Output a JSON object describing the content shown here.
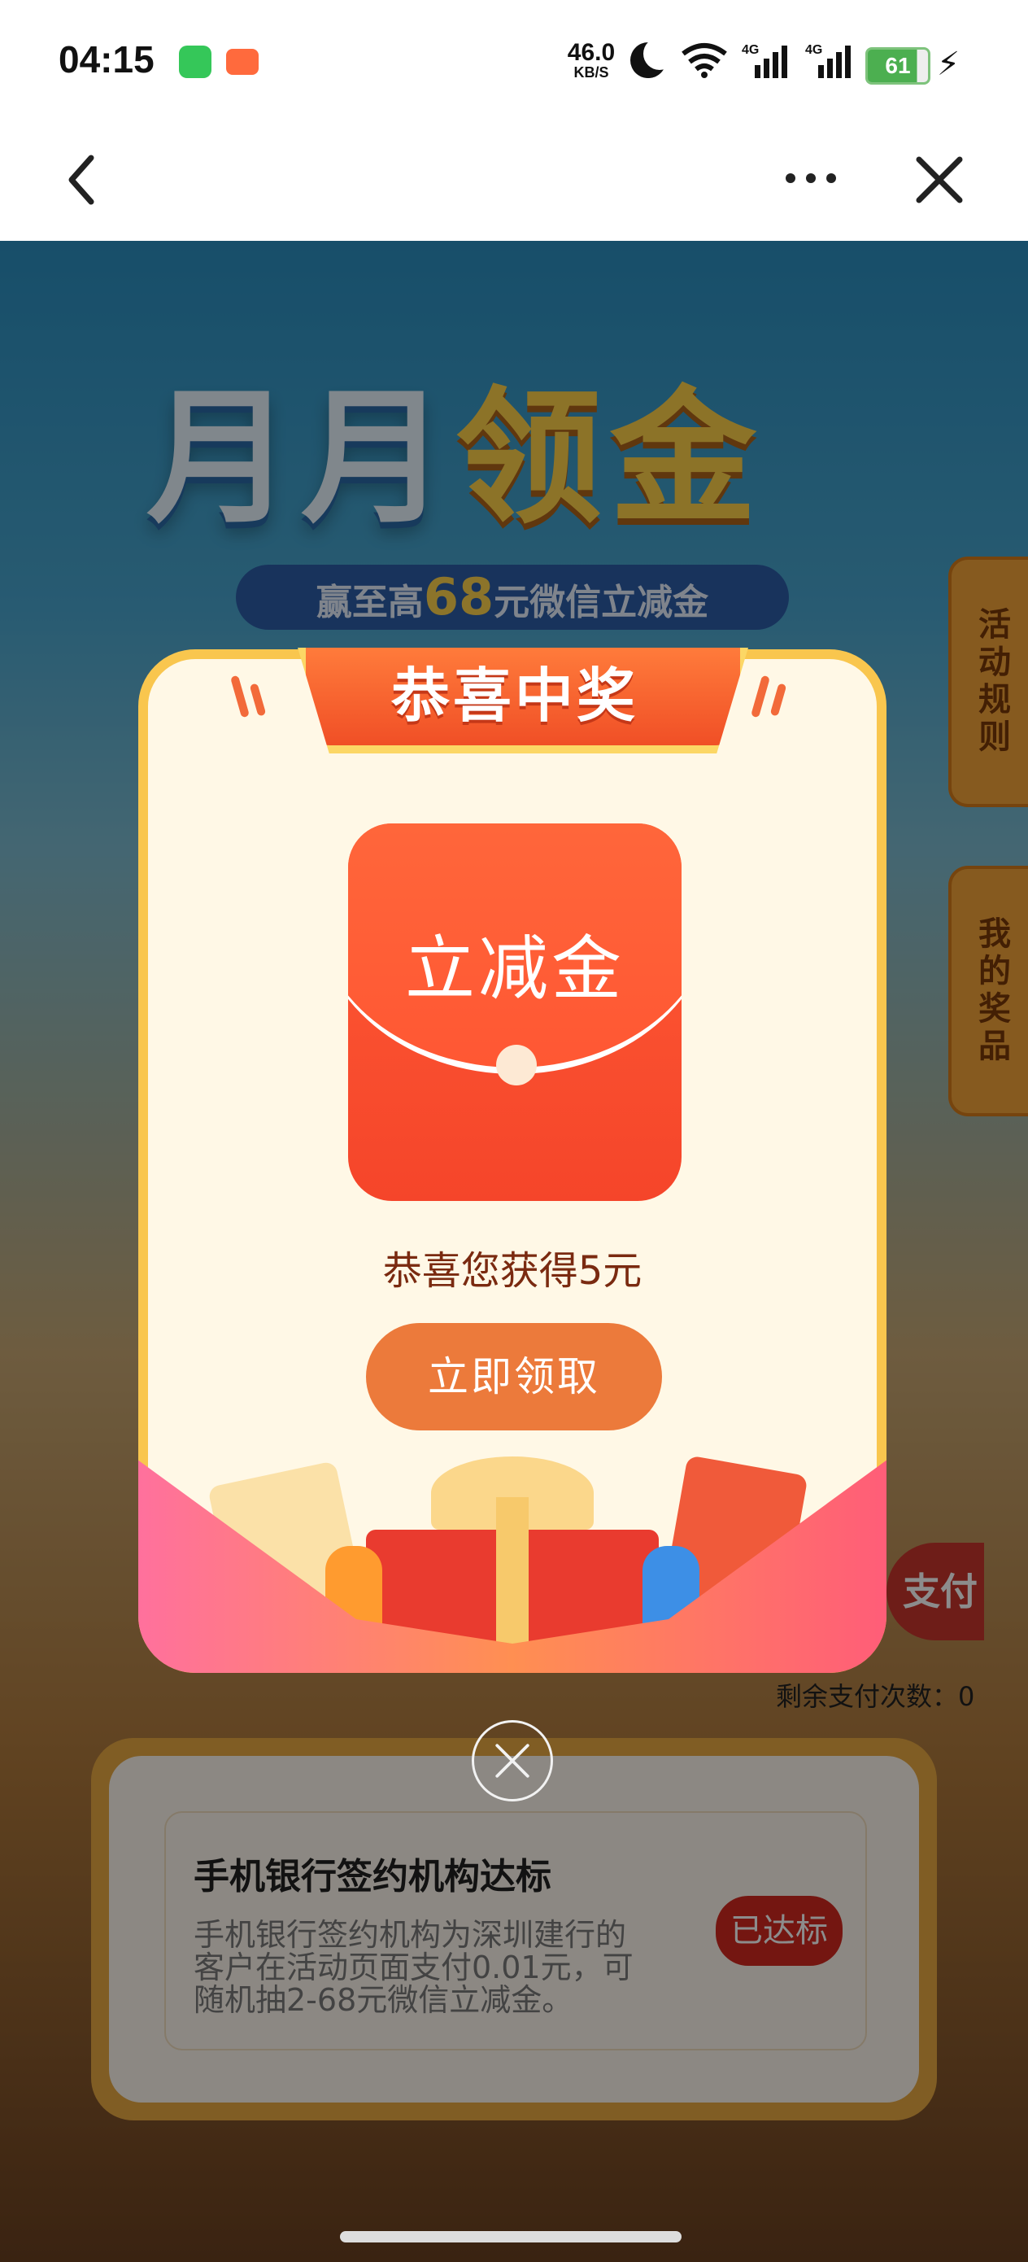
{
  "status_bar": {
    "time": "04:15",
    "net_speed_value": "46.0",
    "net_speed_unit": "KB/S",
    "signal_1_label": "4G",
    "signal_2_label": "4G",
    "battery": "61",
    "icons": [
      "messages-app-icon",
      "game-app-icon",
      "moon-icon",
      "wifi-icon",
      "signal-icon",
      "battery-icon",
      "charging-icon"
    ]
  },
  "nav": {
    "back_icon": "chevron-left-icon",
    "more_icon": "ellipsis-icon",
    "close_icon": "close-icon"
  },
  "banner": {
    "title_part1": "月月",
    "title_part2": "领金",
    "subtitle_prefix": "赢至高",
    "subtitle_amount": "68",
    "subtitle_suffix": "元微信立减金"
  },
  "side_tabs": {
    "rules": "活动规则",
    "prizes": "我的奖品"
  },
  "background": {
    "pay_button_partial": "支付",
    "remaining_label": "剩余支付次数：",
    "remaining_value": "0"
  },
  "task_card": {
    "title": "手机银行签约机构达标",
    "description": "手机银行签约机构为深圳建行的客户在活动页面支付0.01元，可随机抽2-68元微信立减金。",
    "badge": "已达标"
  },
  "modal": {
    "ribbon_title": "恭喜中奖",
    "envelope_label": "立减金",
    "win_message": "恭喜您获得5元",
    "claim_button": "立即领取"
  },
  "colors": {
    "modal_border": "#f9c64e",
    "claim_button": "#ec7a3b",
    "envelope_red": "#f5452a",
    "badge_red": "#d3281f"
  }
}
